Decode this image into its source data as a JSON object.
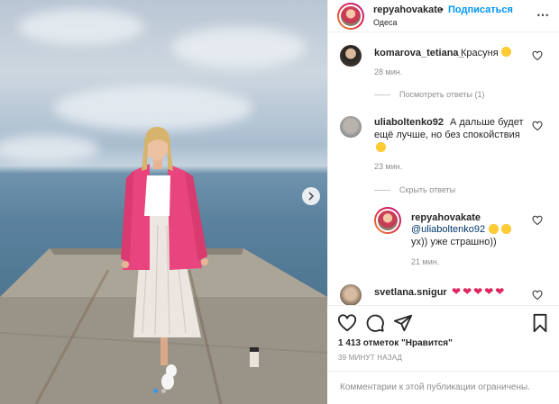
{
  "post": {
    "author": "repyahovakate",
    "separator": "•",
    "follow_label": "Подписаться",
    "location": "Одеса",
    "more_icon": "more-horizontal-icon"
  },
  "comments": [
    {
      "user": "komarova_tetiana_",
      "text": "Красуня",
      "emoji": "heart-eyes-emoji",
      "time": "28 мин.",
      "replies_label": "Посмотреть ответы (1)"
    },
    {
      "user": "uliaboltenko92",
      "text_line1": "А дальше будет",
      "text_line2": "ещё лучше, но без спокойствия",
      "emoji": "grinning-sweat-emoji",
      "time": "23 мин.",
      "replies_label": "Скрыть ответы"
    },
    {
      "user": "repyahovakate",
      "text_line1": "@uliaboltenko92",
      "text_line2": "ух)) уже страшно))",
      "emoji": "nervous-emoji",
      "time": "21 мин."
    },
    {
      "user": "svetlana.snigur",
      "hearts": 5
    }
  ],
  "actions": {
    "like_icon": "heart-icon",
    "comment_icon": "comment-icon",
    "share_icon": "send-icon",
    "save_icon": "bookmark-icon"
  },
  "likes_text": "1 413 отметок \"Нравится\"",
  "time_ago": "39 МИНУТ НАЗАД",
  "comments_limited": "Комментарии к этой публикации ограничены.",
  "colors": {
    "accent": "#0095f6",
    "blazer": "#e8447d",
    "heart": "#e0245e"
  }
}
